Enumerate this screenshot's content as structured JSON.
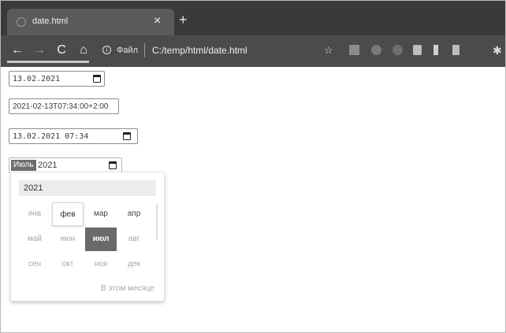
{
  "browser": {
    "tab": {
      "title": "date.html",
      "close_glyph": "×"
    },
    "new_tab_glyph": "+",
    "nav": {
      "back_glyph": "←",
      "forward_glyph": "→",
      "reload_glyph": "C",
      "home_glyph": "⌂"
    },
    "address": {
      "info_glyph": "i",
      "scheme_label": "Файл",
      "url": "C:/temp/html/date.html"
    },
    "extensions": {
      "star_glyph": "☆",
      "puzzle_glyph": "✱"
    }
  },
  "form": {
    "date_input": {
      "value": "13.02.2021"
    },
    "datetime_text_input": {
      "value": "2021-02-13T07:34:00+2:00"
    },
    "datetime_local_input": {
      "value": "13.02.2021 07:34"
    },
    "month_input": {
      "month_segment": "Июль",
      "year_segment": "2021"
    }
  },
  "month_picker": {
    "year_label": "2021",
    "months": [
      "янв",
      "фев",
      "мар",
      "апр",
      "май",
      "июн",
      "июл",
      "авг",
      "сен",
      "окт",
      "ноя",
      "дек"
    ],
    "hovered_month": "фев",
    "selected_month": "июл",
    "this_month_button": "В этом месяце"
  }
}
